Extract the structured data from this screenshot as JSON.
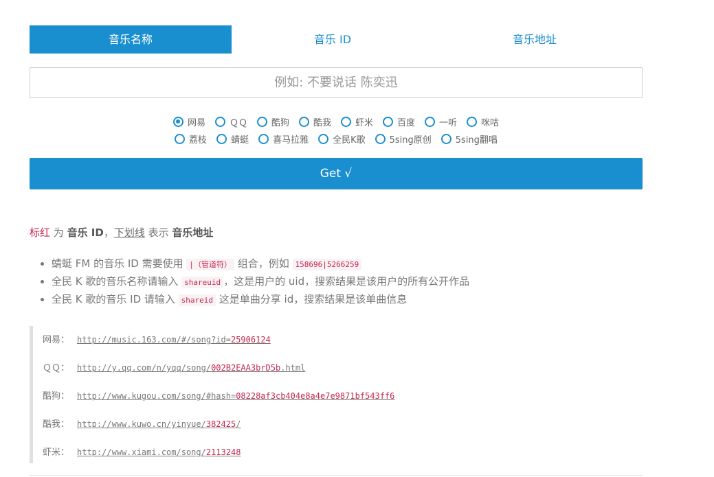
{
  "tabs": [
    {
      "label": "音乐名称",
      "active": true
    },
    {
      "label": "音乐 ID",
      "active": false
    },
    {
      "label": "音乐地址",
      "active": false
    }
  ],
  "search": {
    "placeholder": "例如: 不要说话 陈奕迅",
    "value": ""
  },
  "sources": {
    "row1": [
      "网易",
      "ＱＱ",
      "酷狗",
      "酷我",
      "虾米",
      "百度",
      "一听",
      "咪咕"
    ],
    "row2": [
      "荔枝",
      "蜻蜓",
      "喜马拉雅",
      "全民K歌",
      "5sing原创",
      "5sing翻唱"
    ],
    "selected": "网易"
  },
  "get_button": {
    "label": "Get √"
  },
  "legend": {
    "red_text": "标红",
    "t1": " 为 ",
    "b1": "音乐 ID",
    "t2": "，",
    "underline_text": "下划线",
    "t3": " 表示 ",
    "b2": "音乐地址"
  },
  "notes": [
    {
      "pre": "蜻蜓 FM 的音乐 ID 需要使用 ",
      "code": "|（管道符）",
      "mid": " 组合，例如 ",
      "code2": "158696|5266259",
      "post": ""
    },
    {
      "pre": "全民 K 歌的音乐名称请输入 ",
      "code": "shareuid",
      "mid": "，这是用户的 uid，搜索结果是该用户的所有公开作品",
      "code2": "",
      "post": ""
    },
    {
      "pre": "全民 K 歌的音乐 ID 请输入 ",
      "code": "shareid",
      "mid": " 这是单曲分享 id，搜索结果是该单曲信息",
      "code2": "",
      "post": ""
    }
  ],
  "examples": [
    {
      "label": "网易：",
      "url_prefix": "http://music.163.com/#/song?id=",
      "url_id": "25906124"
    },
    {
      "label": "ＱＱ：",
      "url_prefix": "http://y.qq.com/n/yqq/song/",
      "url_id": "002B2EAA3brD5b",
      "url_suffix": ".html"
    },
    {
      "label": "酷狗：",
      "url_prefix": "http://www.kugou.com/song/#hash=",
      "url_id": "08228af3cb404e8a4e7e9871bf543ff6"
    },
    {
      "label": "酷我：",
      "url_prefix": "http://www.kuwo.cn/yinyue/",
      "url_id": "382425",
      "url_suffix": "/"
    },
    {
      "label": "虾米：",
      "url_prefix": "http://www.xiami.com/song/",
      "url_id": "2113248"
    }
  ],
  "colors": {
    "accent": "#1a8fd0",
    "code_red": "#c7254e"
  }
}
